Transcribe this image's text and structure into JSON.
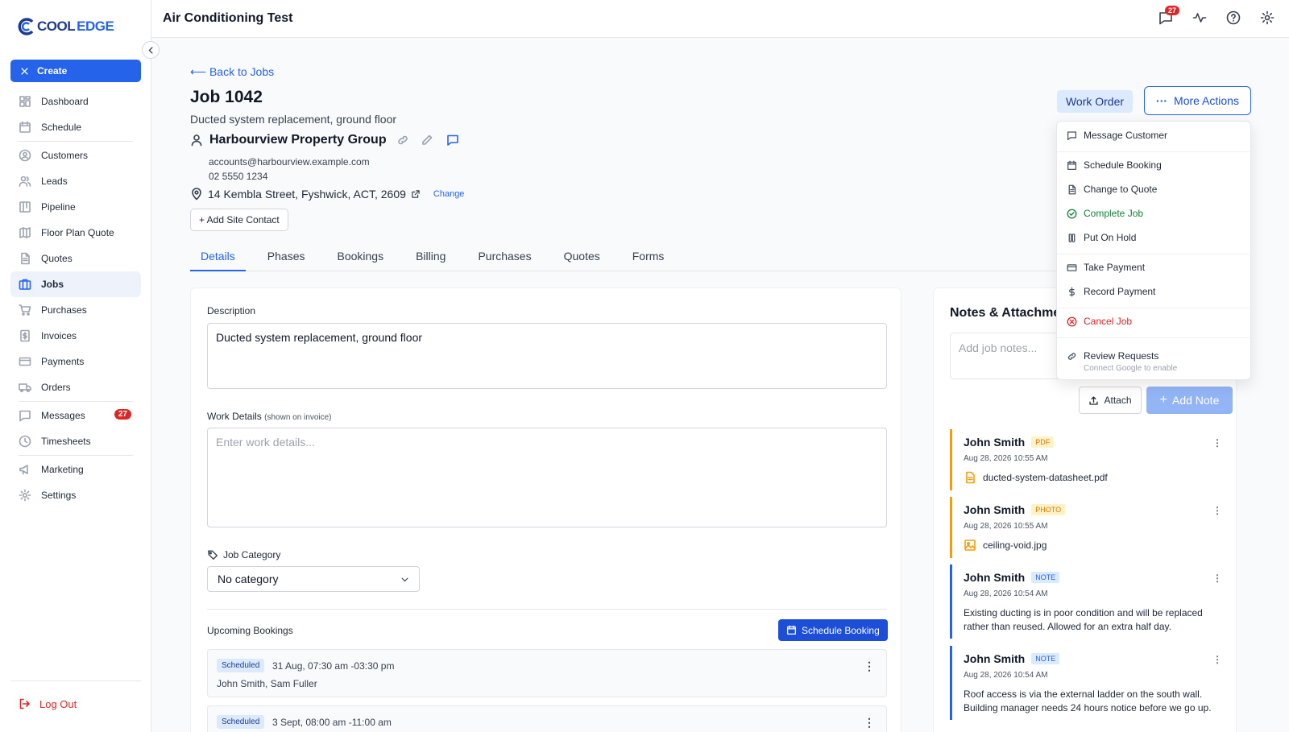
{
  "brand": {
    "logo_c": "C",
    "logo_cool": "COOL",
    "logo_edge": "EDGE"
  },
  "sidebar": {
    "create_label": "Create",
    "items": [
      {
        "label": "Dashboard",
        "icon": "dashboard-icon"
      },
      {
        "label": "Schedule",
        "icon": "calendar-icon"
      },
      {
        "label": "Customers",
        "icon": "customers-icon"
      },
      {
        "label": "Leads",
        "icon": "leads-icon"
      },
      {
        "label": "Pipeline",
        "icon": "pipeline-icon"
      },
      {
        "label": "Floor Plan Quote",
        "icon": "map-icon"
      },
      {
        "label": "Quotes",
        "icon": "document-icon"
      },
      {
        "label": "Jobs",
        "icon": "briefcase-icon",
        "active": true
      },
      {
        "label": "Purchases",
        "icon": "cart-icon"
      },
      {
        "label": "Invoices",
        "icon": "invoice-icon"
      },
      {
        "label": "Payments",
        "icon": "credit-card-icon"
      },
      {
        "label": "Orders",
        "icon": "truck-icon"
      },
      {
        "label": "Messages",
        "icon": "message-icon",
        "badge": "27"
      },
      {
        "label": "Timesheets",
        "icon": "clock-icon"
      },
      {
        "label": "Marketing",
        "icon": "megaphone-icon"
      },
      {
        "label": "Settings",
        "icon": "gear-icon"
      }
    ],
    "logout_label": "Log Out"
  },
  "header": {
    "title": "Air Conditioning Test",
    "messages_badge": "27"
  },
  "job": {
    "back_label": "⟵ Back to Jobs",
    "title": "Job 1042",
    "subtitle": "Ducted system replacement, ground floor",
    "customer_name": "Harbourview Property Group",
    "email": "accounts@harbourview.example.com",
    "phone": "02 5550 1234",
    "address": "14 Kembla Street, Fyshwick, ACT, 2609",
    "change_label": "Change",
    "add_site_contact_label": "+ Add Site Contact",
    "work_order_label": "Work Order",
    "more_actions_label": "More Actions"
  },
  "tabs": [
    "Details",
    "Phases",
    "Bookings",
    "Billing",
    "Purchases",
    "Quotes",
    "Forms"
  ],
  "details": {
    "description_label": "Description",
    "description_value": "Ducted system replacement, ground floor",
    "work_details_label": "Work Details",
    "work_details_note": "(shown on invoice)",
    "work_details_placeholder": "Enter work details...",
    "category_label": "Job Category",
    "category_value": "No category",
    "upcoming_label": "Upcoming Bookings",
    "schedule_booking_label": "Schedule Booking",
    "bookings": [
      {
        "status": "Scheduled",
        "time": "31 Aug, 07:30 am -03:30 pm",
        "people": "John Smith, Sam Fuller"
      },
      {
        "status": "Scheduled",
        "time": "3 Sept, 08:00 am -11:00 am",
        "people": ""
      }
    ]
  },
  "notes": {
    "title": "Notes & Attachments",
    "placeholder": "Add job notes...",
    "attach_label": "Attach",
    "add_note_label": "Add Note",
    "entries": [
      {
        "author": "John Smith",
        "tag": "PDF",
        "date": "Aug 28, 2026 10:55 AM",
        "file": "ducted-system-datasheet.pdf"
      },
      {
        "author": "John Smith",
        "tag": "PHOTO",
        "date": "Aug 28, 2026 10:55 AM",
        "file": "ceiling-void.jpg"
      },
      {
        "author": "John Smith",
        "tag": "NOTE",
        "date": "Aug 28, 2026 10:54 AM",
        "text": "Existing ducting is in poor condition and will be replaced rather than reused. Allowed for an extra half day."
      },
      {
        "author": "John Smith",
        "tag": "NOTE",
        "date": "Aug 28, 2026 10:54 AM",
        "text": "Roof access is via the external ladder on the south wall. Building manager needs 24 hours notice before we go up."
      }
    ]
  },
  "more_actions_menu": {
    "items": [
      "Message Customer",
      "Schedule Booking",
      "Change to Quote",
      "Complete Job",
      "Put On Hold",
      "Take Payment",
      "Record Payment",
      "Cancel Job",
      "Review Requests"
    ],
    "review_requests_sub": "Connect Google to enable"
  },
  "colors": {
    "accent": "#2563eb",
    "danger": "#dc2626",
    "success": "#15803d",
    "warning": "#f59e0b"
  }
}
